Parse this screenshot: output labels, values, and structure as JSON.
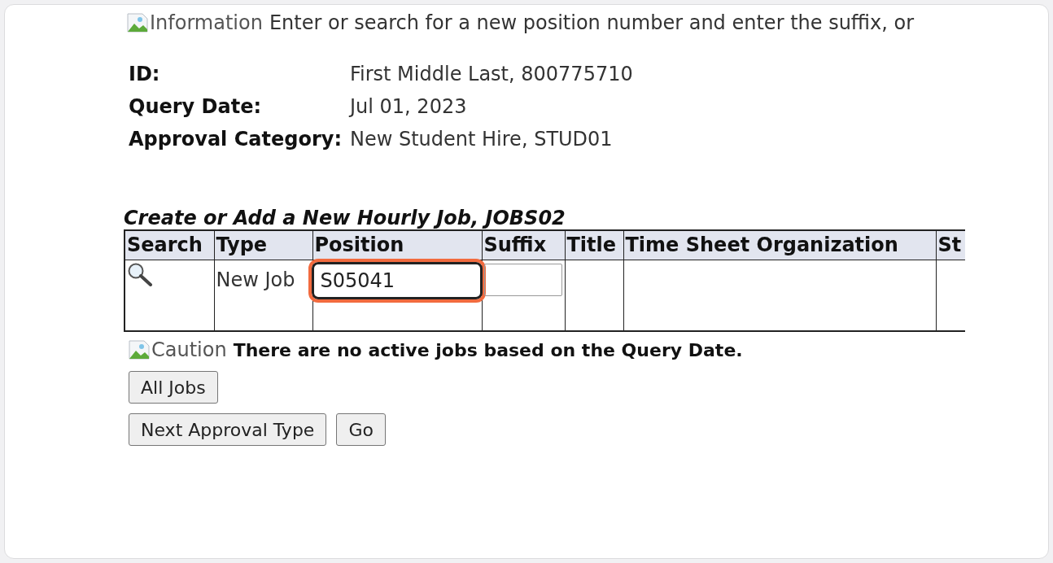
{
  "info": {
    "icon_alt": "Information",
    "text": "Enter or search for a new position number and enter the suffix, or"
  },
  "details": [
    {
      "label": "ID:",
      "value": "First Middle Last, 800775710"
    },
    {
      "label": "Query Date:",
      "value": "Jul 01, 2023"
    },
    {
      "label": "Approval Category:",
      "value": "New Student Hire, STUD01"
    }
  ],
  "table": {
    "title": "Create or Add a New Hourly Job, JOBS02",
    "columns": [
      "Search",
      "Type",
      "Position",
      "Suffix",
      "Title",
      "Time Sheet Organization",
      "St"
    ],
    "rows": [
      {
        "type": "New Job",
        "position": "S05041",
        "position_focused": true
      }
    ]
  },
  "caution": {
    "icon_alt": "Caution",
    "text": "There are no active jobs based on the Query Date."
  },
  "button_rows": [
    {
      "buttons": [
        "All Jobs"
      ]
    },
    {
      "buttons": [
        "Next Approval Type",
        "Go"
      ]
    }
  ]
}
